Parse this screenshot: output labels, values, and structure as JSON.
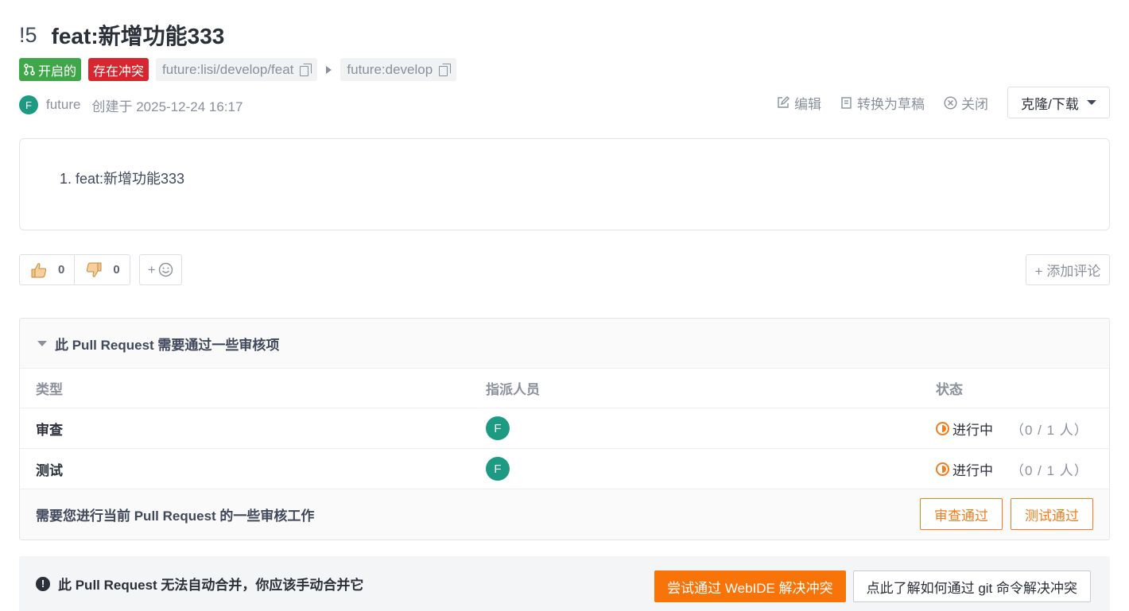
{
  "pr": {
    "number": "!5",
    "title": "feat:新增功能333",
    "status_tag": "开启的",
    "conflict_tag": "存在冲突",
    "source_branch": "future:lisi/develop/feat",
    "target_branch": "future:develop"
  },
  "author": {
    "initial": "F",
    "name": "future",
    "created": "创建于 2025-12-24 16:17"
  },
  "actions": {
    "edit": "编辑",
    "to_draft": "转换为草稿",
    "close": "关闭",
    "clone": "克隆/下载"
  },
  "description": {
    "items": [
      "1. feat:新增功能333"
    ]
  },
  "reactions": {
    "thumbs_up_count": "0",
    "thumbs_down_count": "0",
    "add_emoji": "+",
    "add_comment": "+ 添加评论"
  },
  "review": {
    "heading": "此 Pull Request 需要通过一些审核项",
    "columns": [
      "类型",
      "指派人员",
      "状态"
    ],
    "rows": [
      {
        "type": "审查",
        "assignee_initial": "F",
        "status": "进行中",
        "count": "（0 / 1 人）"
      },
      {
        "type": "测试",
        "assignee_initial": "F",
        "status": "进行中",
        "count": "（0 / 1 人）"
      }
    ],
    "footer_text": "需要您进行当前 Pull Request 的一些审核工作",
    "approve_review": "审查通过",
    "approve_test": "测试通过"
  },
  "conflict": {
    "message": "此 Pull Request 无法自动合并，你应该手动合并它",
    "webide_button": "尝试通过 WebIDE 解决冲突",
    "git_button": "点此了解如何通过 git 命令解决冲突"
  },
  "colors": {
    "open_green": "#3fa64a",
    "conflict_red": "#d6262f",
    "accent_orange": "#f87308",
    "avatar_teal": "#1d9b82"
  }
}
